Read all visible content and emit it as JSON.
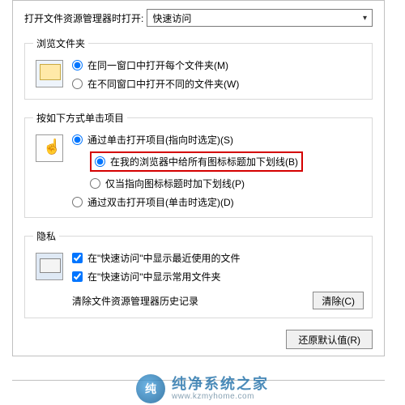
{
  "top": {
    "label": "打开文件资源管理器时打开:",
    "combo_value": "快速访问"
  },
  "group_browse": {
    "legend": "浏览文件夹",
    "opts": [
      {
        "label": "在同一窗口中打开每个文件夹(M)",
        "checked": true
      },
      {
        "label": "在不同窗口中打开不同的文件夹(W)",
        "checked": false
      }
    ]
  },
  "group_click": {
    "legend": "按如下方式单击项目",
    "opts": [
      {
        "label": "通过单击打开项目(指向时选定)(S)",
        "checked": true,
        "indent": false
      },
      {
        "label": "在我的浏览器中给所有图标标题加下划线(B)",
        "checked": true,
        "indent": true,
        "highlight": true
      },
      {
        "label": "仅当指向图标标题时加下划线(P)",
        "checked": false,
        "indent": true
      },
      {
        "label": "通过双击打开项目(单击时选定)(D)",
        "checked": false,
        "indent": false
      }
    ]
  },
  "group_privacy": {
    "legend": "隐私",
    "checks": [
      {
        "label": "在\"快速访问\"中显示最近使用的文件",
        "checked": true
      },
      {
        "label": "在\"快速访问\"中显示常用文件夹",
        "checked": true
      }
    ],
    "history_label": "清除文件资源管理器历史记录",
    "clear_btn": "清除(C)"
  },
  "restore_btn": "还原默认值(R)",
  "watermark": {
    "cn": "纯净系统之家",
    "en": "www.kzmyhome.com"
  }
}
